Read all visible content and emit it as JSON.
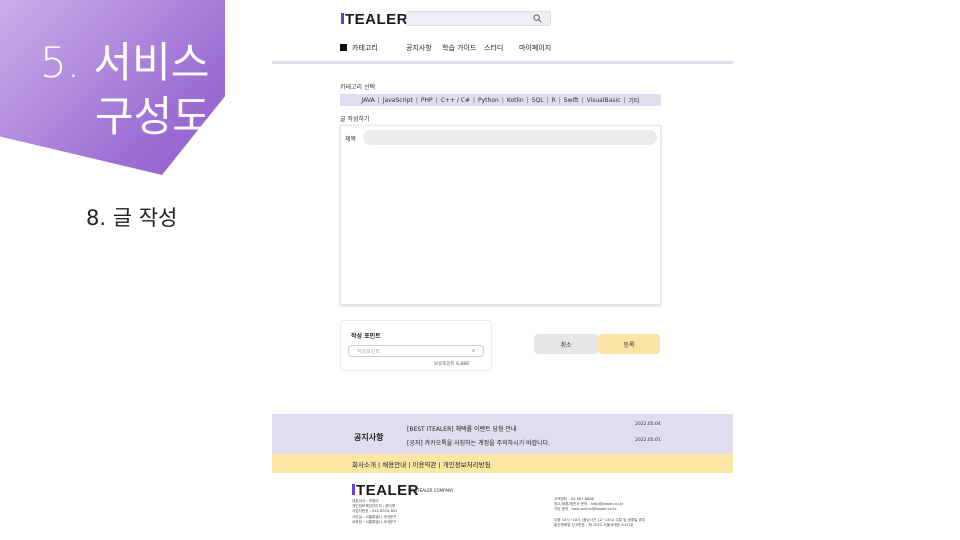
{
  "slide": {
    "title_line1": "5. 서비스",
    "title_line2": "구성도",
    "subtitle": "8. 글 작성"
  },
  "header": {
    "logo": "TEALER",
    "search_placeholder": "",
    "nav": [
      "카테고리",
      "공지사항",
      "학습 가이드",
      "스터디",
      "마이페이지"
    ]
  },
  "category": {
    "label": "카테고리 선택",
    "items": [
      "JAVA",
      "JavaScript",
      "PHP",
      "C++ / C#",
      "Python",
      "Kotlin",
      "SQL",
      "R",
      "Swift",
      "VisualBasic",
      "기타"
    ]
  },
  "write": {
    "label": "글 작성하기",
    "title_label": "제목",
    "title_value": ""
  },
  "points": {
    "title": "작성 포인트",
    "placeholder": "작성포인트",
    "clear": "x",
    "owned": "보유포인트 6,888"
  },
  "buttons": {
    "cancel": "취소",
    "submit": "등록"
  },
  "footer": {
    "notice_label": "공지사항",
    "notices": [
      {
        "text": "[BEST ITEALER] 채택률 이벤트 당첨 안내",
        "date": "2022.05.04"
      },
      {
        "text": "[공지] 카카오톡을 사칭하는 계정을 주의하시기 바랍니다.",
        "date": "2022.05.01"
      }
    ],
    "links": "회사소개 | 채용안내 | 이용약관 | 개인정보처리방침",
    "logo": "TEALER",
    "company": "(주) ITEALER COMPANY",
    "left_info": [
      "대표이사 : 조명아",
      "개인정보책임관리자 : 윤다영",
      "사업자번호 : 542-8524-852",
      "사무실 : 서울특별시 서대문구",
      "교육장 : 서울특별시 서대문구"
    ],
    "right_info": [
      "고객센터 : 02-587-8888",
      "광고/제휴/제안서 문의 : help@itealer.co.kr",
      "기타 문의 : help.online@itealer.co.kr",
      "",
      "주중 10시~18시 (점심시간 12~13시) 주말 및 공휴일 휴무",
      "통신판매업 신고번호 : 제 2022-서울서대문-2041호"
    ]
  }
}
